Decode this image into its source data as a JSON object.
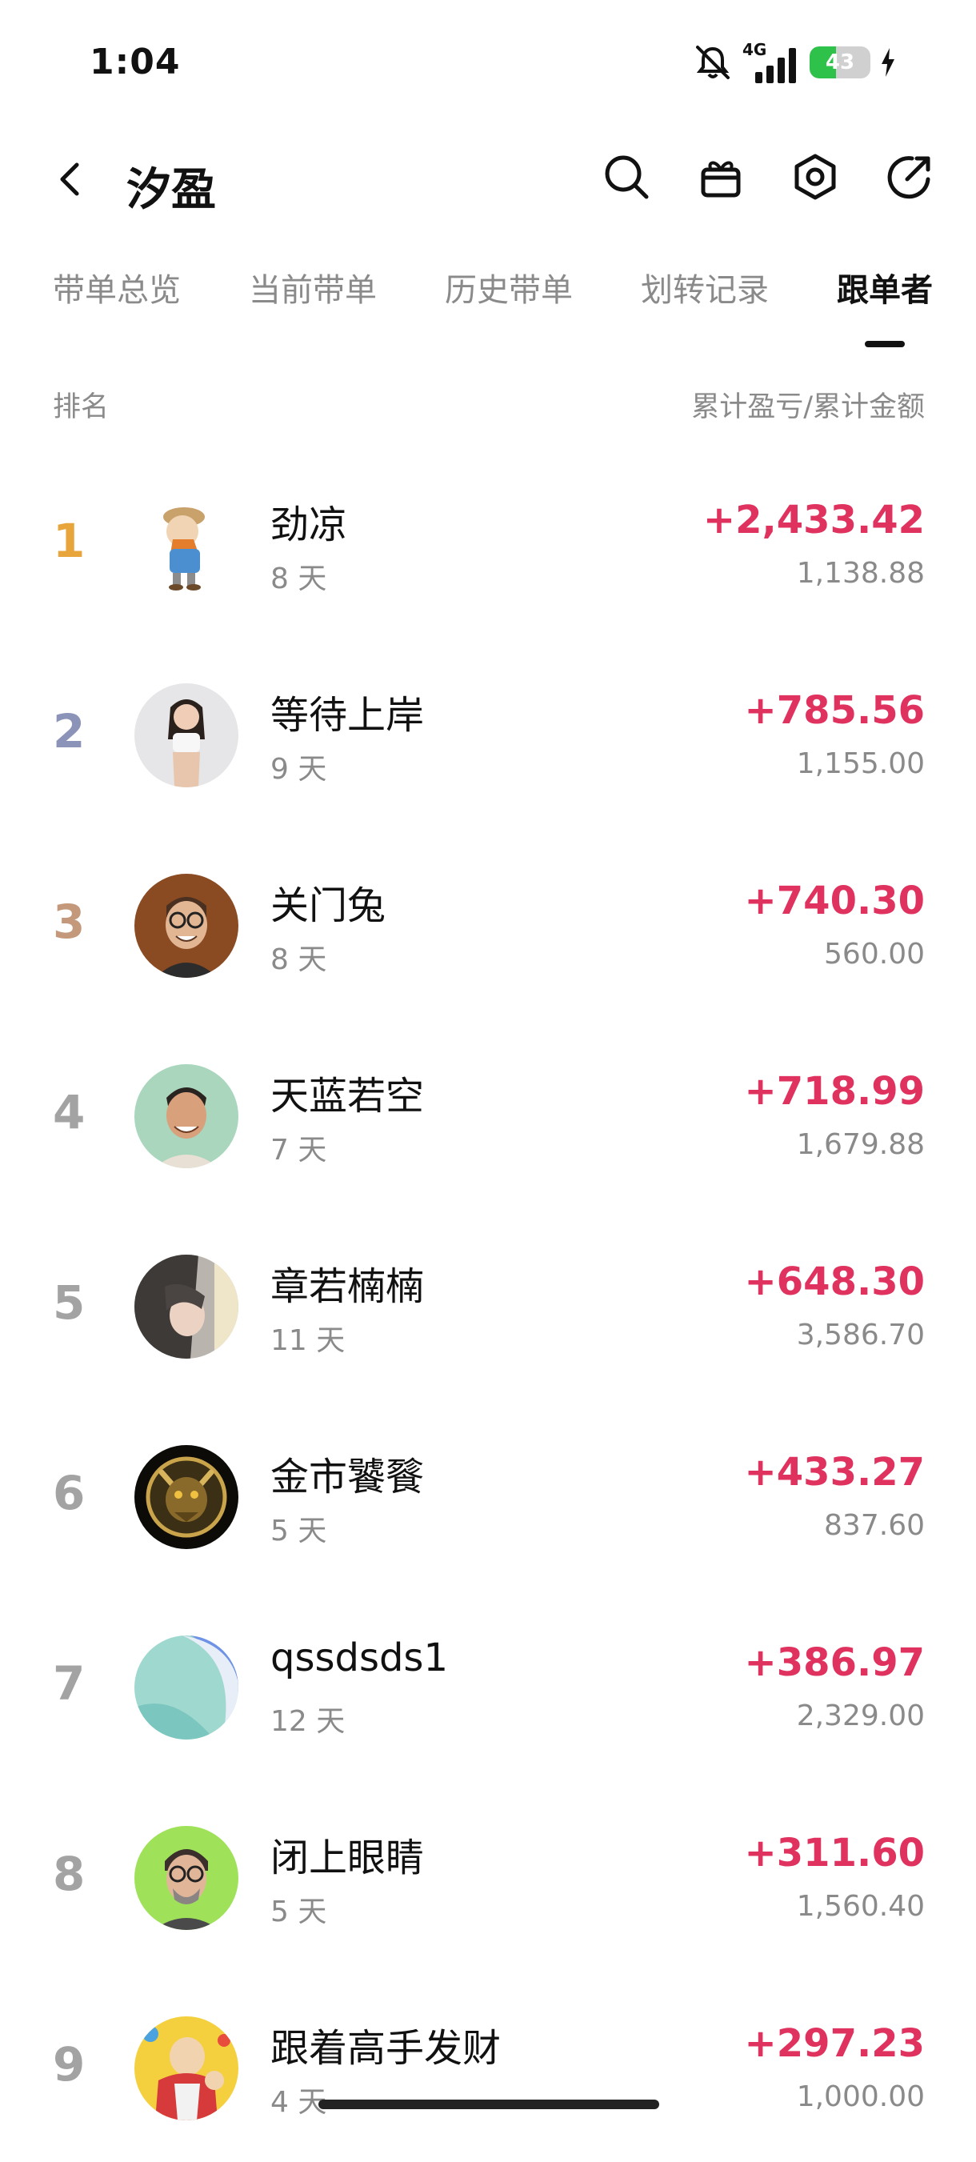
{
  "status_bar": {
    "time": "1:04",
    "network": "4G",
    "battery": "43",
    "battery_level_percent": 43
  },
  "header": {
    "title": "汐盈"
  },
  "tabs": [
    {
      "label": "带单总览"
    },
    {
      "label": "当前带单"
    },
    {
      "label": "历史带单"
    },
    {
      "label": "划转记录"
    },
    {
      "label": "跟单者"
    }
  ],
  "list_header": {
    "left": "排名",
    "right": "累计盈亏/累计金额"
  },
  "followers": [
    {
      "rank": "1",
      "name": "劲凉",
      "days": "8 天",
      "profit": "+2,433.42",
      "amount": "1,138.88"
    },
    {
      "rank": "2",
      "name": "等待上岸",
      "days": "9 天",
      "profit": "+785.56",
      "amount": "1,155.00"
    },
    {
      "rank": "3",
      "name": "关门兔",
      "days": "8 天",
      "profit": "+740.30",
      "amount": "560.00"
    },
    {
      "rank": "4",
      "name": "天蓝若空",
      "days": "7 天",
      "profit": "+718.99",
      "amount": "1,679.88"
    },
    {
      "rank": "5",
      "name": "章若楠楠",
      "days": "11 天",
      "profit": "+648.30",
      "amount": "3,586.70"
    },
    {
      "rank": "6",
      "name": "金市饕餮",
      "days": "5 天",
      "profit": "+433.27",
      "amount": "837.60"
    },
    {
      "rank": "7",
      "name": "qssdsds1",
      "days": "12 天",
      "profit": "+386.97",
      "amount": "2,329.00"
    },
    {
      "rank": "8",
      "name": "闭上眼睛",
      "days": "5 天",
      "profit": "+311.60",
      "amount": "1,560.40"
    },
    {
      "rank": "9",
      "name": "跟着高手发财",
      "days": "4 天",
      "profit": "+297.23",
      "amount": "1,000.00"
    }
  ],
  "colors": {
    "profit": "#e0325e",
    "rank_gold": "#e8a53c",
    "rank_silver": "#8c93b8",
    "rank_bronze": "#c4987a",
    "rank_default": "#a3a3a3"
  },
  "icons": [
    "back-icon",
    "search-icon",
    "gift-icon",
    "settings-icon",
    "share-icon",
    "mute-icon",
    "signal-icon",
    "charging-icon"
  ]
}
